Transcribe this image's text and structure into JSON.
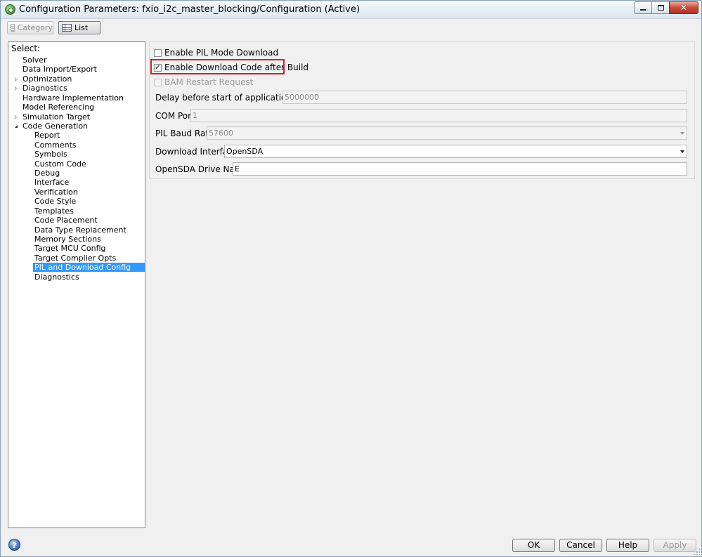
{
  "window": {
    "title": "Configuration Parameters: fxio_i2c_master_blocking/Configuration (Active)",
    "controls": {
      "minimize": "",
      "maximize": "",
      "close": "✕"
    }
  },
  "toolbar": {
    "category_label": "Category",
    "list_label": "List"
  },
  "tree": {
    "header": "Select:",
    "items": [
      {
        "label": "Solver",
        "indent": 1,
        "expander": "",
        "selected": false
      },
      {
        "label": "Data Import/Export",
        "indent": 1,
        "expander": "",
        "selected": false
      },
      {
        "label": "Optimization",
        "indent": 1,
        "expander": "closed",
        "selected": false
      },
      {
        "label": "Diagnostics",
        "indent": 1,
        "expander": "closed",
        "selected": false
      },
      {
        "label": "Hardware Implementation",
        "indent": 1,
        "expander": "",
        "selected": false
      },
      {
        "label": "Model Referencing",
        "indent": 1,
        "expander": "",
        "selected": false
      },
      {
        "label": "Simulation Target",
        "indent": 1,
        "expander": "closed",
        "selected": false
      },
      {
        "label": "Code Generation",
        "indent": 1,
        "expander": "open",
        "selected": false
      },
      {
        "label": "Report",
        "indent": 2,
        "expander": "",
        "selected": false
      },
      {
        "label": "Comments",
        "indent": 2,
        "expander": "",
        "selected": false
      },
      {
        "label": "Symbols",
        "indent": 2,
        "expander": "",
        "selected": false
      },
      {
        "label": "Custom Code",
        "indent": 2,
        "expander": "",
        "selected": false
      },
      {
        "label": "Debug",
        "indent": 2,
        "expander": "",
        "selected": false
      },
      {
        "label": "Interface",
        "indent": 2,
        "expander": "",
        "selected": false
      },
      {
        "label": "Verification",
        "indent": 2,
        "expander": "",
        "selected": false
      },
      {
        "label": "Code Style",
        "indent": 2,
        "expander": "",
        "selected": false
      },
      {
        "label": "Templates",
        "indent": 2,
        "expander": "",
        "selected": false
      },
      {
        "label": "Code Placement",
        "indent": 2,
        "expander": "",
        "selected": false
      },
      {
        "label": "Data Type Replacement",
        "indent": 2,
        "expander": "",
        "selected": false
      },
      {
        "label": "Memory Sections",
        "indent": 2,
        "expander": "",
        "selected": false
      },
      {
        "label": "Target MCU Config",
        "indent": 2,
        "expander": "",
        "selected": false
      },
      {
        "label": "Target Compiler Opts",
        "indent": 2,
        "expander": "",
        "selected": false
      },
      {
        "label": "PIL and Download Config",
        "indent": 2,
        "expander": "",
        "selected": true
      },
      {
        "label": "Diagnostics",
        "indent": 2,
        "expander": "",
        "selected": false
      }
    ]
  },
  "settings": {
    "enable_pil": {
      "label": "Enable PIL Mode Download",
      "checked": false
    },
    "enable_download": {
      "label": "Enable Download Code after Build",
      "checked": true
    },
    "bam_restart": {
      "label": "BAM Restart Request",
      "checked": false
    },
    "delay": {
      "label": "Delay before start of application (us)",
      "value": "5000000"
    },
    "com_port": {
      "label": "COM Port",
      "value": "1"
    },
    "baud_rate": {
      "label": "PIL Baud Rate",
      "value": "57600"
    },
    "download_interface": {
      "label": "Download Interface",
      "value": "OpenSDA"
    },
    "drive_name": {
      "label": "OpenSDA Drive Name",
      "value": "E"
    }
  },
  "buttons": {
    "help_icon": "?",
    "ok": "OK",
    "cancel": "Cancel",
    "help": "Help",
    "apply": "Apply"
  },
  "colors": {
    "selection": "#3399ff",
    "highlight_border": "#d21e2b"
  }
}
